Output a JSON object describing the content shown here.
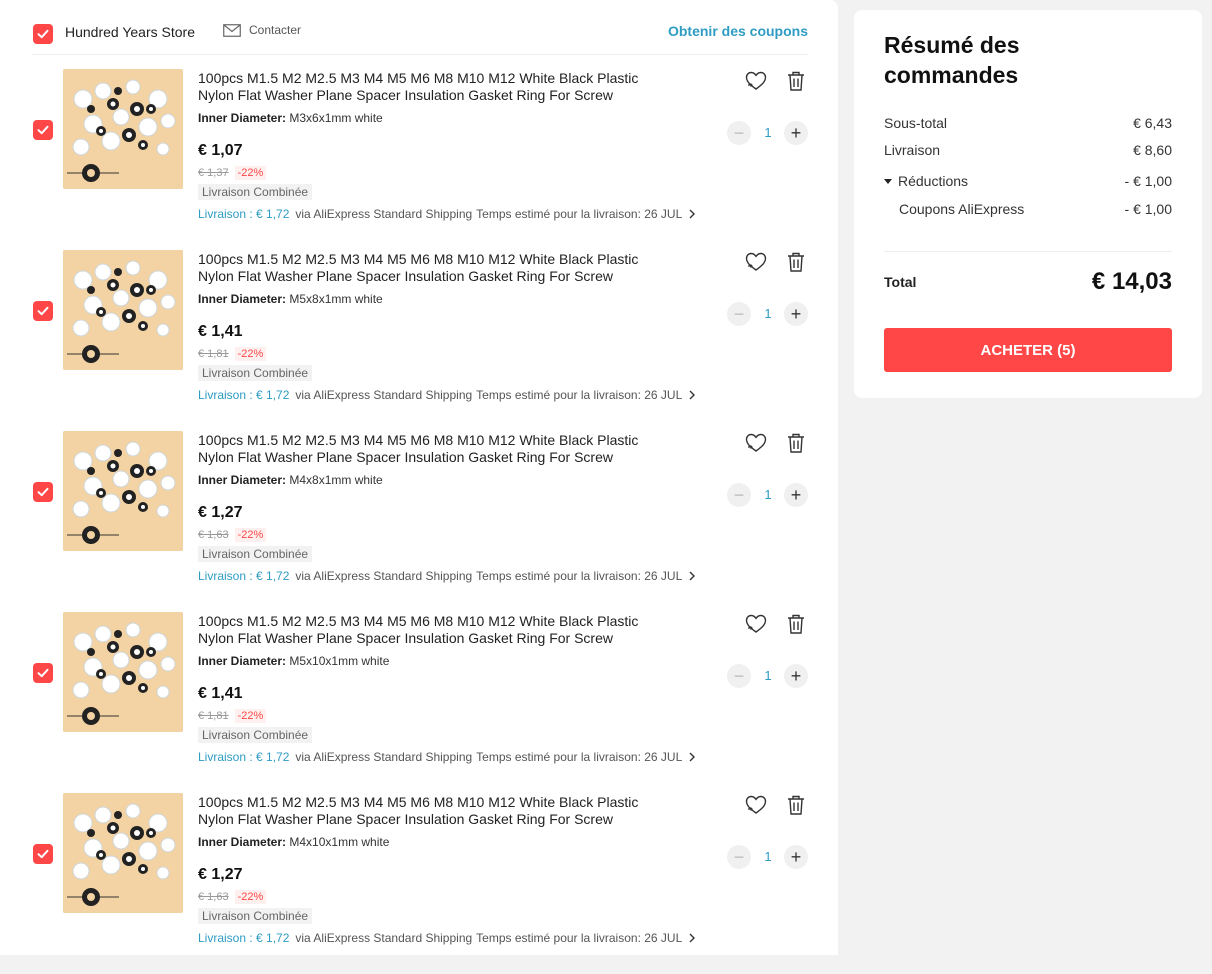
{
  "store": {
    "name": "Hundred Years Store",
    "contact_label": "Contacter",
    "coupons_label": "Obtenir des coupons"
  },
  "items": [
    {
      "title_line1": "100pcs M1.5 M2 M2.5 M3 M4 M5 M6 M8 M10 M12 White Black Plastic",
      "title_line2": "Nylon Flat Washer Plane Spacer Insulation Gasket Ring For Screw",
      "variant_label": "Inner Diameter:",
      "variant_value": "M3x6x1mm white",
      "price": "€ 1,07",
      "old_price": "€ 1,37",
      "discount": "-22%",
      "combined": "Livraison Combinée",
      "shipping_cost": "Livraison : € 1,72",
      "shipping_method": "via AliExpress Standard Shipping",
      "delivery_estimate": "Temps estimé pour la livraison: 26 JUL",
      "quantity": "1"
    },
    {
      "title_line1": "100pcs M1.5 M2 M2.5 M3 M4 M5 M6 M8 M10 M12 White Black Plastic",
      "title_line2": "Nylon Flat Washer Plane Spacer Insulation Gasket Ring For Screw",
      "variant_label": "Inner Diameter:",
      "variant_value": "M5x8x1mm white",
      "price": "€ 1,41",
      "old_price": "€ 1,81",
      "discount": "-22%",
      "combined": "Livraison Combinée",
      "shipping_cost": "Livraison : € 1,72",
      "shipping_method": "via AliExpress Standard Shipping",
      "delivery_estimate": "Temps estimé pour la livraison: 26 JUL",
      "quantity": "1"
    },
    {
      "title_line1": "100pcs M1.5 M2 M2.5 M3 M4 M5 M6 M8 M10 M12 White Black Plastic",
      "title_line2": "Nylon Flat Washer Plane Spacer Insulation Gasket Ring For Screw",
      "variant_label": "Inner Diameter:",
      "variant_value": "M4x8x1mm white",
      "price": "€ 1,27",
      "old_price": "€ 1,63",
      "discount": "-22%",
      "combined": "Livraison Combinée",
      "shipping_cost": "Livraison : € 1,72",
      "shipping_method": "via AliExpress Standard Shipping",
      "delivery_estimate": "Temps estimé pour la livraison: 26 JUL",
      "quantity": "1"
    },
    {
      "title_line1": "100pcs M1.5 M2 M2.5 M3 M4 M5 M6 M8 M10 M12 White Black Plastic",
      "title_line2": "Nylon Flat Washer Plane Spacer Insulation Gasket Ring For Screw",
      "variant_label": "Inner Diameter:",
      "variant_value": "M5x10x1mm white",
      "price": "€ 1,41",
      "old_price": "€ 1,81",
      "discount": "-22%",
      "combined": "Livraison Combinée",
      "shipping_cost": "Livraison : € 1,72",
      "shipping_method": "via AliExpress Standard Shipping",
      "delivery_estimate": "Temps estimé pour la livraison: 26 JUL",
      "quantity": "1"
    },
    {
      "title_line1": "100pcs M1.5 M2 M2.5 M3 M4 M5 M6 M8 M10 M12 White Black Plastic",
      "title_line2": "Nylon Flat Washer Plane Spacer Insulation Gasket Ring For Screw",
      "variant_label": "Inner Diameter:",
      "variant_value": "M4x10x1mm white",
      "price": "€ 1,27",
      "old_price": "€ 1,63",
      "discount": "-22%",
      "combined": "Livraison Combinée",
      "shipping_cost": "Livraison : € 1,72",
      "shipping_method": "via AliExpress Standard Shipping",
      "delivery_estimate": "Temps estimé pour la livraison: 26 JUL",
      "quantity": "1"
    }
  ],
  "summary": {
    "title": "Résumé des commandes",
    "subtotal_label": "Sous-total",
    "subtotal_value": "€ 6,43",
    "shipping_label": "Livraison",
    "shipping_value": "€ 8,60",
    "reductions_label": "Réductions",
    "reductions_value": "- € 1,00",
    "coupons_label": "Coupons AliExpress",
    "coupons_value": "- € 1,00",
    "total_label": "Total",
    "total_value": "€ 14,03",
    "buy_label": "ACHETER (5)"
  },
  "colors": {
    "accent": "#ff4747",
    "link": "#2e9cc3",
    "thumbnail_bg": "#f3d3a3"
  },
  "icons": [
    "check-icon",
    "mail-icon",
    "heart-icon",
    "trash-icon",
    "minus-icon",
    "plus-icon",
    "chevron-right-icon",
    "caret-down-icon"
  ]
}
